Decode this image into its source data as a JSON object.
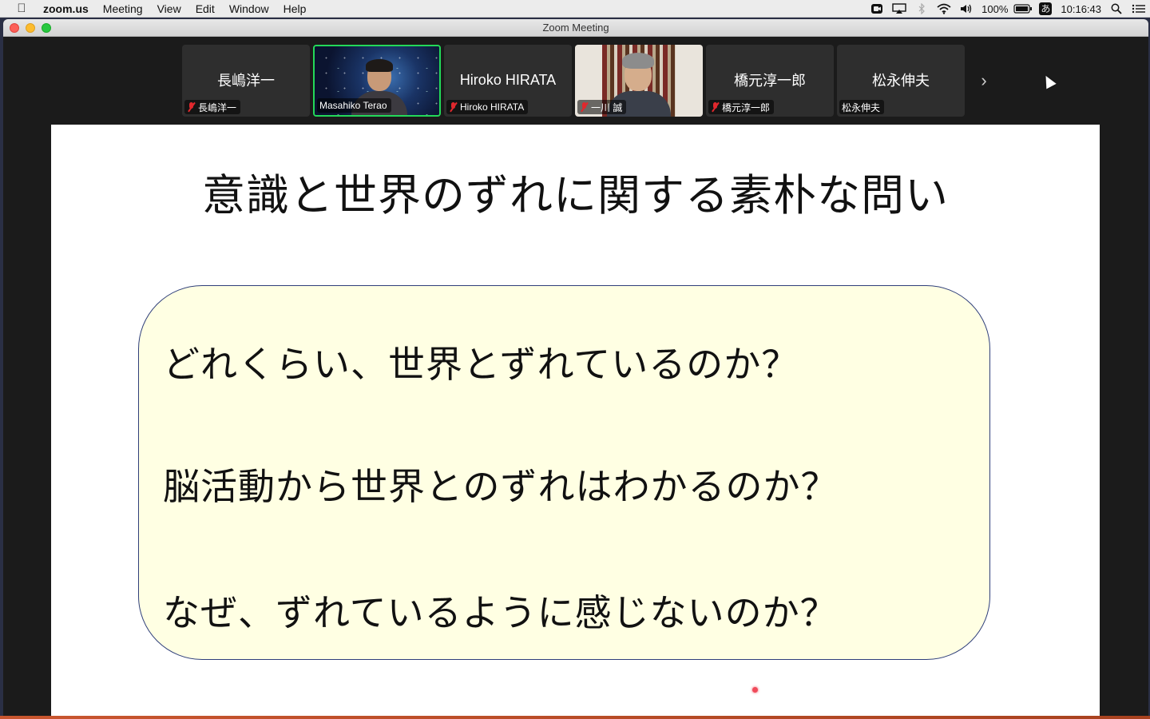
{
  "menubar": {
    "app_name": "zoom.us",
    "menus": [
      "Meeting",
      "View",
      "Edit",
      "Window",
      "Help"
    ],
    "battery": "100%",
    "input_method": "あ",
    "clock": "10:16:43"
  },
  "window": {
    "title": "Zoom Meeting"
  },
  "participants": [
    {
      "display": "長嶋洋一",
      "label": "長嶋洋一",
      "muted": true,
      "video": false
    },
    {
      "display": "",
      "label": "Masahiko Terao",
      "muted": false,
      "video": true,
      "active_speaker": true
    },
    {
      "display": "Hiroko HIRATA",
      "label": "Hiroko HIRATA",
      "muted": true,
      "video": false
    },
    {
      "display": "",
      "label": "一川 誠",
      "muted": true,
      "video": true
    },
    {
      "display": "橋元淳一郎",
      "label": "橋元淳一郎",
      "muted": true,
      "video": false
    },
    {
      "display": "松永伸夫",
      "label": "松永伸夫",
      "muted": false,
      "video": false
    }
  ],
  "strip_next_glyph": "›",
  "slide": {
    "title": "意識と世界のずれに関する素朴な問い",
    "questions": [
      "どれくらい、世界とずれているのか？",
      "脳活動から世界とのずれはわかるのか？",
      "なぜ、ずれているように感じないのか？"
    ]
  },
  "colors": {
    "active_speaker_border": "#23d959",
    "question_box_fill": "#ffffe3",
    "question_box_border": "#2f3f7a",
    "mute_red": "#e0282d"
  }
}
